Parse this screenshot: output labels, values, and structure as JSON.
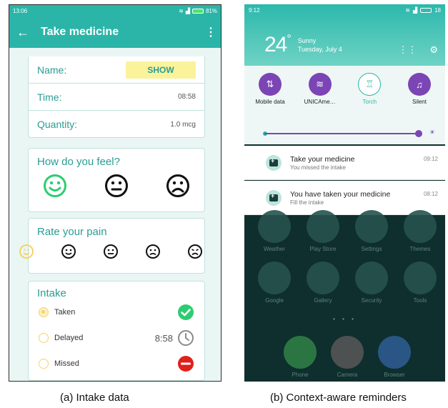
{
  "screenA": {
    "status_time": "13:06",
    "status_battery": "81%",
    "title": "Take medicine",
    "details": {
      "name_label": "Name:",
      "show_button": "SHOW",
      "time_label": "Time:",
      "time_value": "08:58",
      "quantity_label": "Quantity:",
      "quantity_value": "1.0 mcg"
    },
    "feel_title": "How do you feel?",
    "pain_title": "Rate your pain",
    "intake_title": "Intake",
    "intake": {
      "taken_label": "Taken",
      "delayed_label": "Delayed",
      "delayed_time": "8:58",
      "missed_label": "Missed"
    },
    "colors": {
      "accent": "#2bb5a8",
      "taken": "#2ecc71",
      "missed": "#e0201b"
    }
  },
  "screenB": {
    "status_time": "9:12",
    "status_battery": "18",
    "temperature": "24",
    "weather": "Sunny",
    "date": "Tuesday, July 4",
    "toggles": {
      "mobile_data": "Mobile data",
      "wifi": "UNICAme…",
      "torch": "Torch",
      "silent": "Silent"
    },
    "notifications": [
      {
        "title": "Take your medicine",
        "subtitle": "You missed the intake",
        "time": "09:12"
      },
      {
        "title": "You have taken your medicine",
        "subtitle": "Fill the intake",
        "time": "08:12"
      }
    ],
    "apps": {
      "weather": "Weather",
      "play_store": "Play Store",
      "settings": "Settings",
      "themes": "Themes",
      "google": "Google",
      "gallery": "Gallery",
      "security": "Security",
      "tools": "Tools",
      "phone": "Phone",
      "camera": "Camera",
      "browser": "Browser"
    }
  },
  "captions": {
    "a": "(a)  Intake data",
    "b": "(b)  Context-aware reminders"
  }
}
